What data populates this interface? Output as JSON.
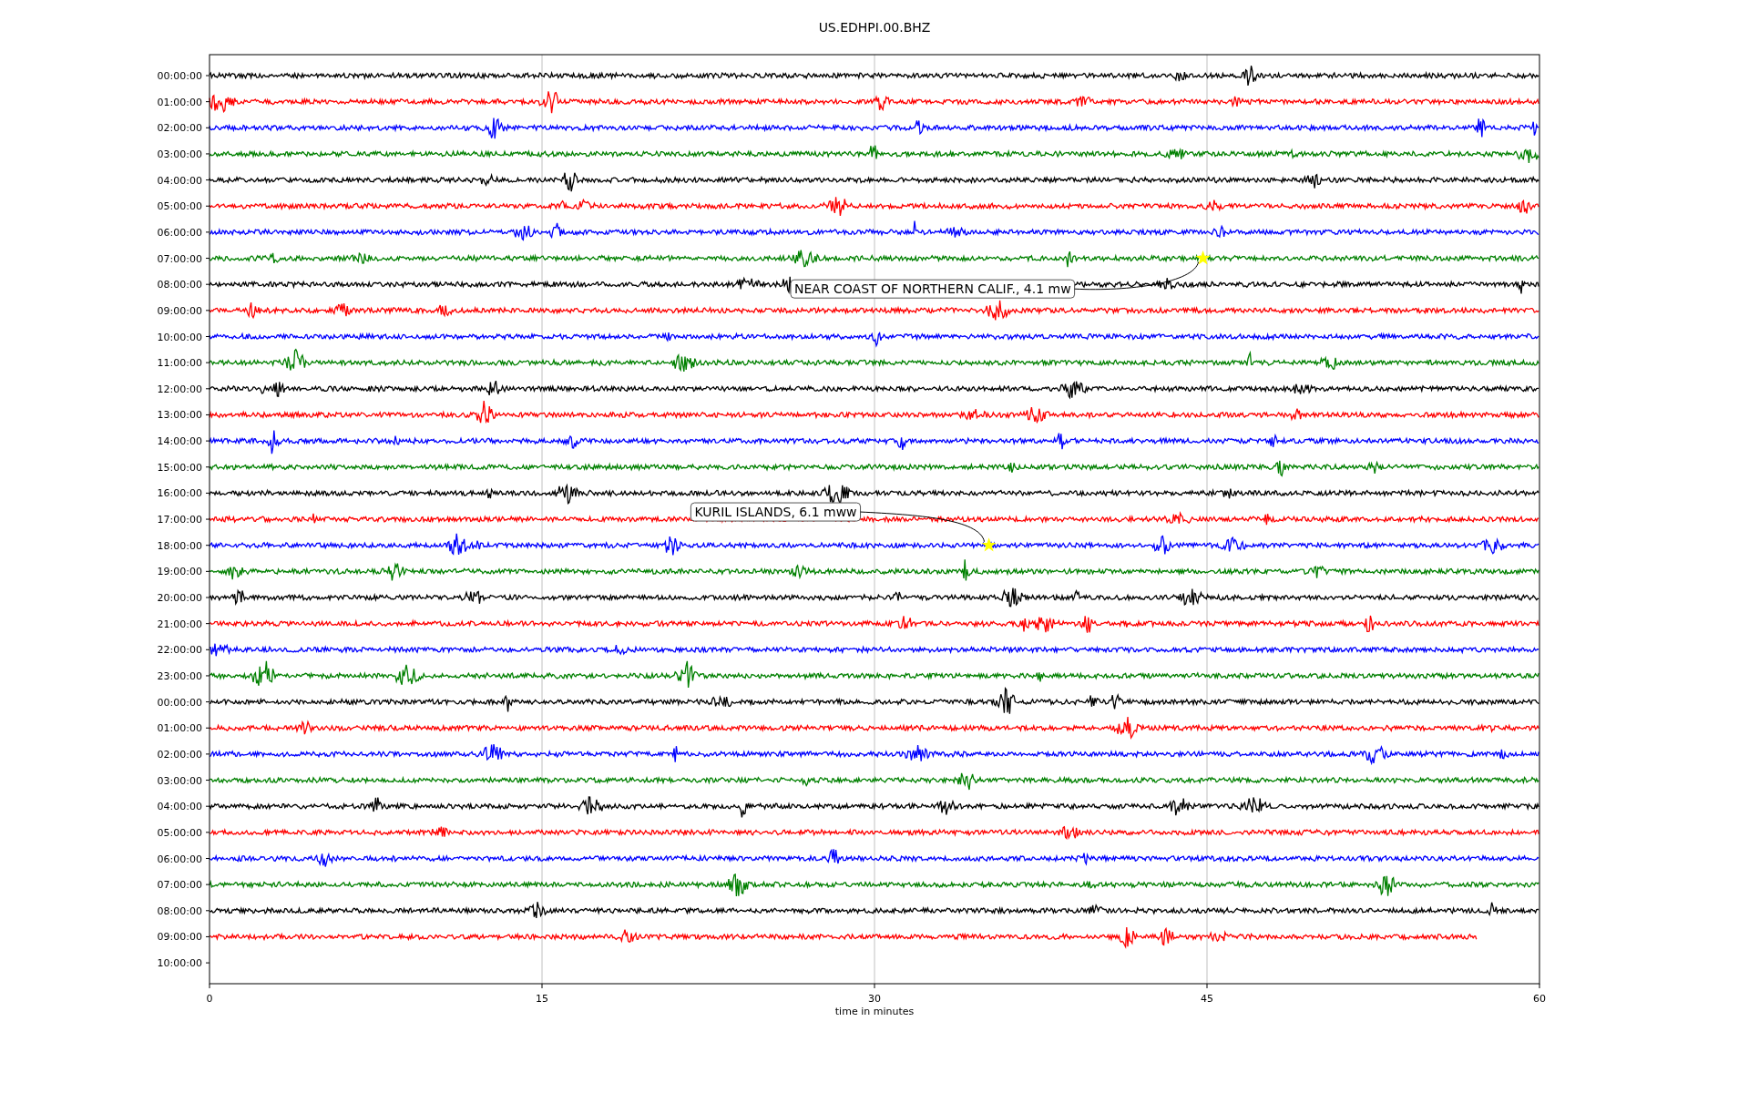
{
  "title": "US.EDHPI.00.BHZ",
  "xlabel": "time in minutes",
  "xticks": [
    "0",
    "15",
    "30",
    "45",
    "60"
  ],
  "rows": [
    {
      "label": "00:00:00",
      "color": "#000000",
      "level": 1
    },
    {
      "label": "01:00:00",
      "color": "#ff0000",
      "level": 1
    },
    {
      "label": "02:00:00",
      "color": "#0000ff",
      "level": 1
    },
    {
      "label": "03:00:00",
      "color": "#008000",
      "level": 1
    },
    {
      "label": "04:00:00",
      "color": "#000000",
      "level": 1
    },
    {
      "label": "05:00:00",
      "color": "#ff0000",
      "level": 1
    },
    {
      "label": "06:00:00",
      "color": "#0000ff",
      "level": 1
    },
    {
      "label": "07:00:00",
      "color": "#008000",
      "level": 1,
      "event": {
        "text": "NEAR COAST OF NORTHERN CALIF., 4.1 mw",
        "level": 0.747,
        "kind": "below"
      }
    },
    {
      "label": "08:00:00",
      "color": "#000000",
      "level": 1
    },
    {
      "label": "09:00:00",
      "color": "#ff0000",
      "level": 1
    },
    {
      "label": "10:00:00",
      "color": "#0000ff",
      "level": 1
    },
    {
      "label": "11:00:00",
      "color": "#008000",
      "level": 1
    },
    {
      "label": "12:00:00",
      "color": "#000000",
      "level": 1
    },
    {
      "label": "13:00:00",
      "color": "#ff0000",
      "level": 1
    },
    {
      "label": "14:00:00",
      "color": "#0000ff",
      "level": 1
    },
    {
      "label": "15:00:00",
      "color": "#008000",
      "level": 1
    },
    {
      "label": "16:00:00",
      "color": "#000000",
      "level": 1
    },
    {
      "label": "17:00:00",
      "color": "#ff0000",
      "level": 1
    },
    {
      "label": "18:00:00",
      "color": "#0000ff",
      "level": 1,
      "event": {
        "text": "KURIL ISLANDS, 6.1 mww",
        "level": 0.586,
        "kind": "above"
      }
    },
    {
      "label": "19:00:00",
      "color": "#008000",
      "level": 1
    },
    {
      "label": "20:00:00",
      "color": "#000000",
      "level": 1
    },
    {
      "label": "21:00:00",
      "color": "#ff0000",
      "level": 1
    },
    {
      "label": "22:00:00",
      "color": "#0000ff",
      "level": 1
    },
    {
      "label": "23:00:00",
      "color": "#008000",
      "level": 1
    },
    {
      "label": "00:00:00",
      "color": "#000000",
      "level": 1
    },
    {
      "label": "01:00:00",
      "color": "#ff0000",
      "level": 1
    },
    {
      "label": "02:00:00",
      "color": "#0000ff",
      "level": 1
    },
    {
      "label": "03:00:00",
      "color": "#008000",
      "level": 1
    },
    {
      "label": "04:00:00",
      "color": "#000000",
      "level": 1
    },
    {
      "label": "05:00:00",
      "color": "#ff0000",
      "level": 1
    },
    {
      "label": "06:00:00",
      "color": "#0000ff",
      "level": 1
    },
    {
      "label": "07:00:00",
      "color": "#008000",
      "level": 1
    },
    {
      "label": "08:00:00",
      "color": "#000000",
      "level": 1
    },
    {
      "label": "09:00:00",
      "color": "#ff0000",
      "level": 0.953
    },
    {
      "label": "10:00:00"
    }
  ]
}
